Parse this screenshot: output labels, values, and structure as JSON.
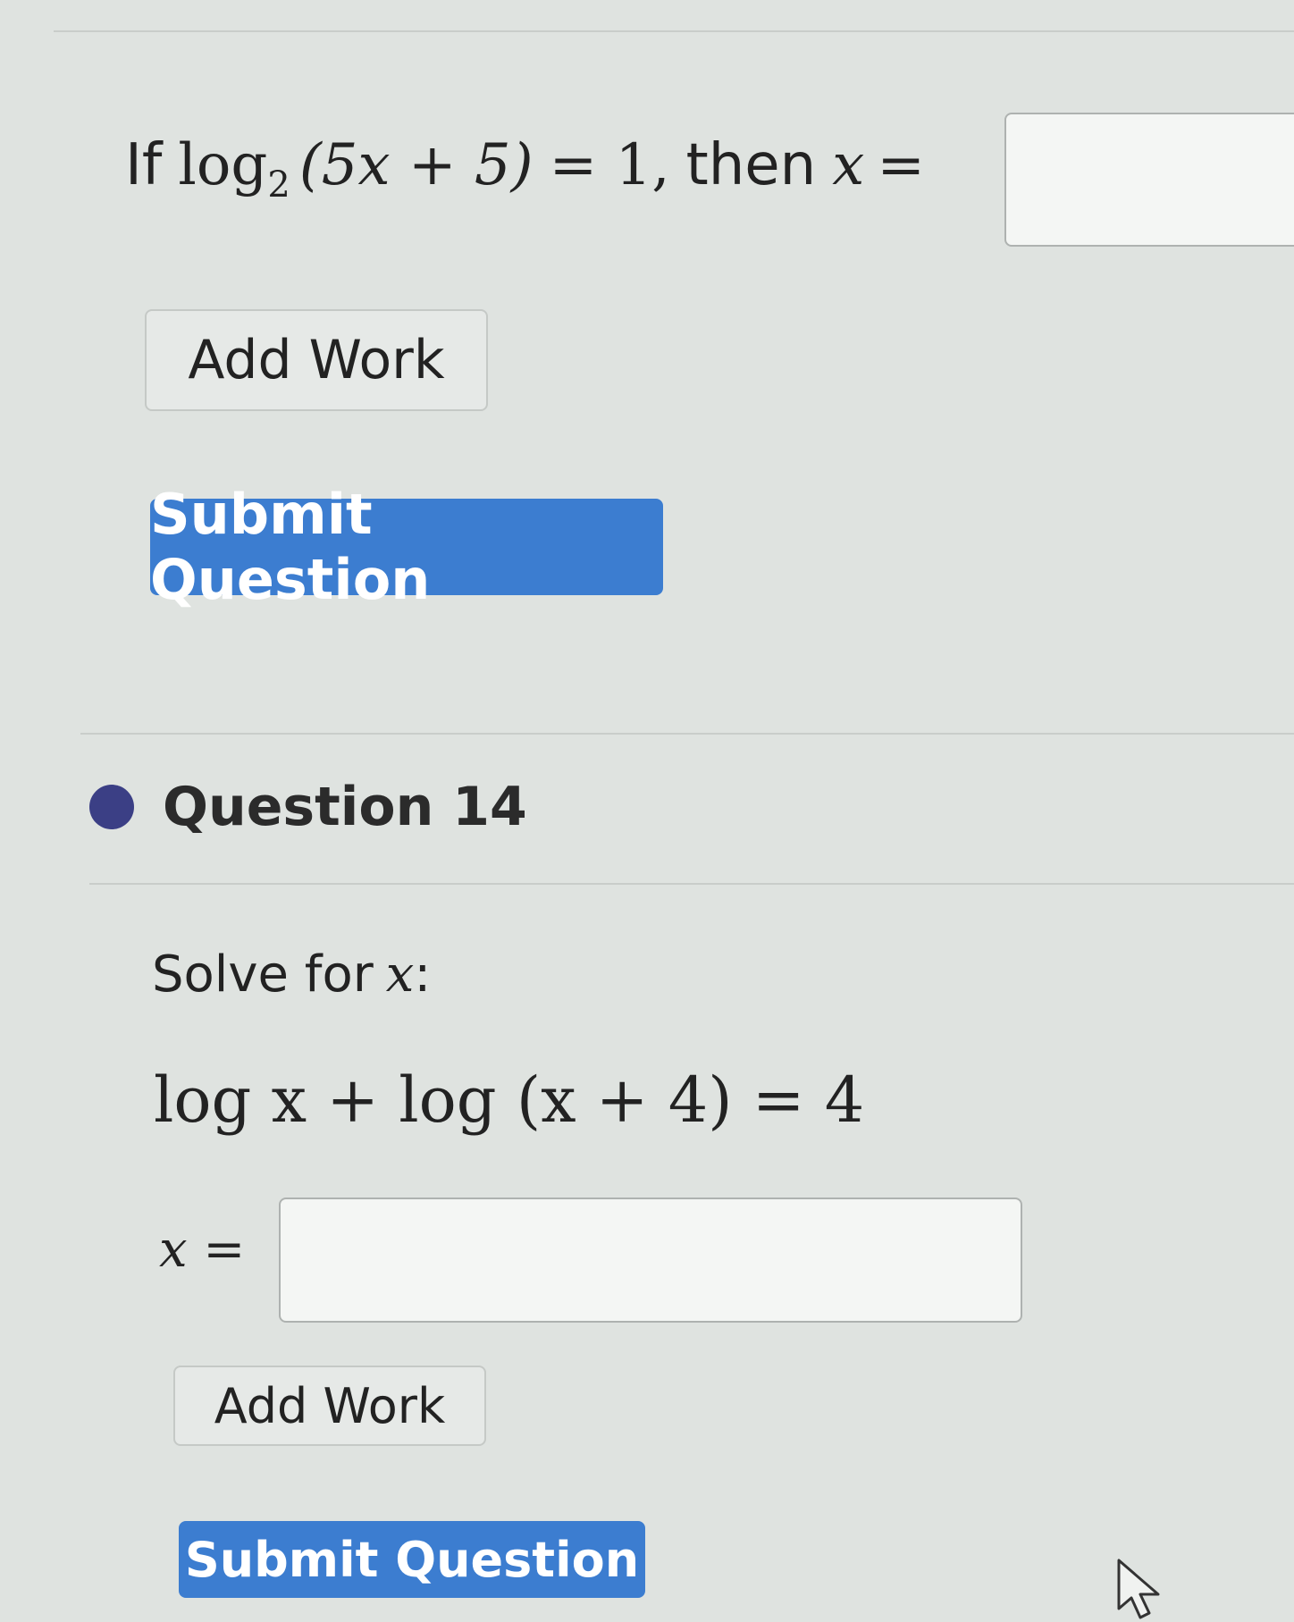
{
  "question13": {
    "prompt_if": "If",
    "log_word": "log",
    "log_base": "2",
    "log_argument": "(5x + 5)",
    "equals_one": "= 1,",
    "then_word": "then",
    "x_var": "x",
    "equals": "=",
    "answer_value": "",
    "add_work_label": "Add Work",
    "submit_label": "Submit Question"
  },
  "question14": {
    "header": "Question 14",
    "status_color": "#3b3f85",
    "solve_prompt": "Solve for",
    "solve_var": "x",
    "solve_colon": ":",
    "equation": "log x + log (x + 4) = 4",
    "answer_prefix": "x =",
    "answer_value": "",
    "add_work_label": "Add Work",
    "submit_label": "Submit Question"
  },
  "colors": {
    "submit_button": "#3c7dd0",
    "background": "#dfe3e0"
  },
  "icons": {
    "cursor": "mouse-pointer-icon"
  }
}
